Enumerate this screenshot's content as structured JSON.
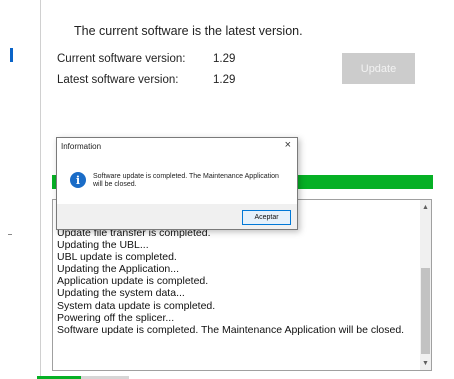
{
  "status": {
    "message": "The current software is the latest version."
  },
  "versions": {
    "current_label": "Current software version:",
    "current_value": "1.29",
    "latest_label": "Latest software version:",
    "latest_value": "1.29"
  },
  "update_button": {
    "label": "Update",
    "enabled": false
  },
  "progress": {
    "fraction": 1.0,
    "color": "#06b025"
  },
  "log": {
    "lines": [
      "Update file transfer is completed.",
      "Updating the UBL...",
      "UBL update is completed.",
      "Updating the Application...",
      "Application update is completed.",
      "Updating the system data...",
      "System data update is completed.",
      "Powering off the splicer...",
      "Software update is completed. The Maintenance Application will be closed."
    ]
  },
  "dialog": {
    "title": "Information",
    "close_glyph": "×",
    "icon": "info-icon",
    "message": "Software update is completed. The Maintenance Application will be closed.",
    "ok_label": "Aceptar"
  },
  "colors": {
    "accent_blue": "#0a64c8",
    "progress_green": "#06b025"
  }
}
